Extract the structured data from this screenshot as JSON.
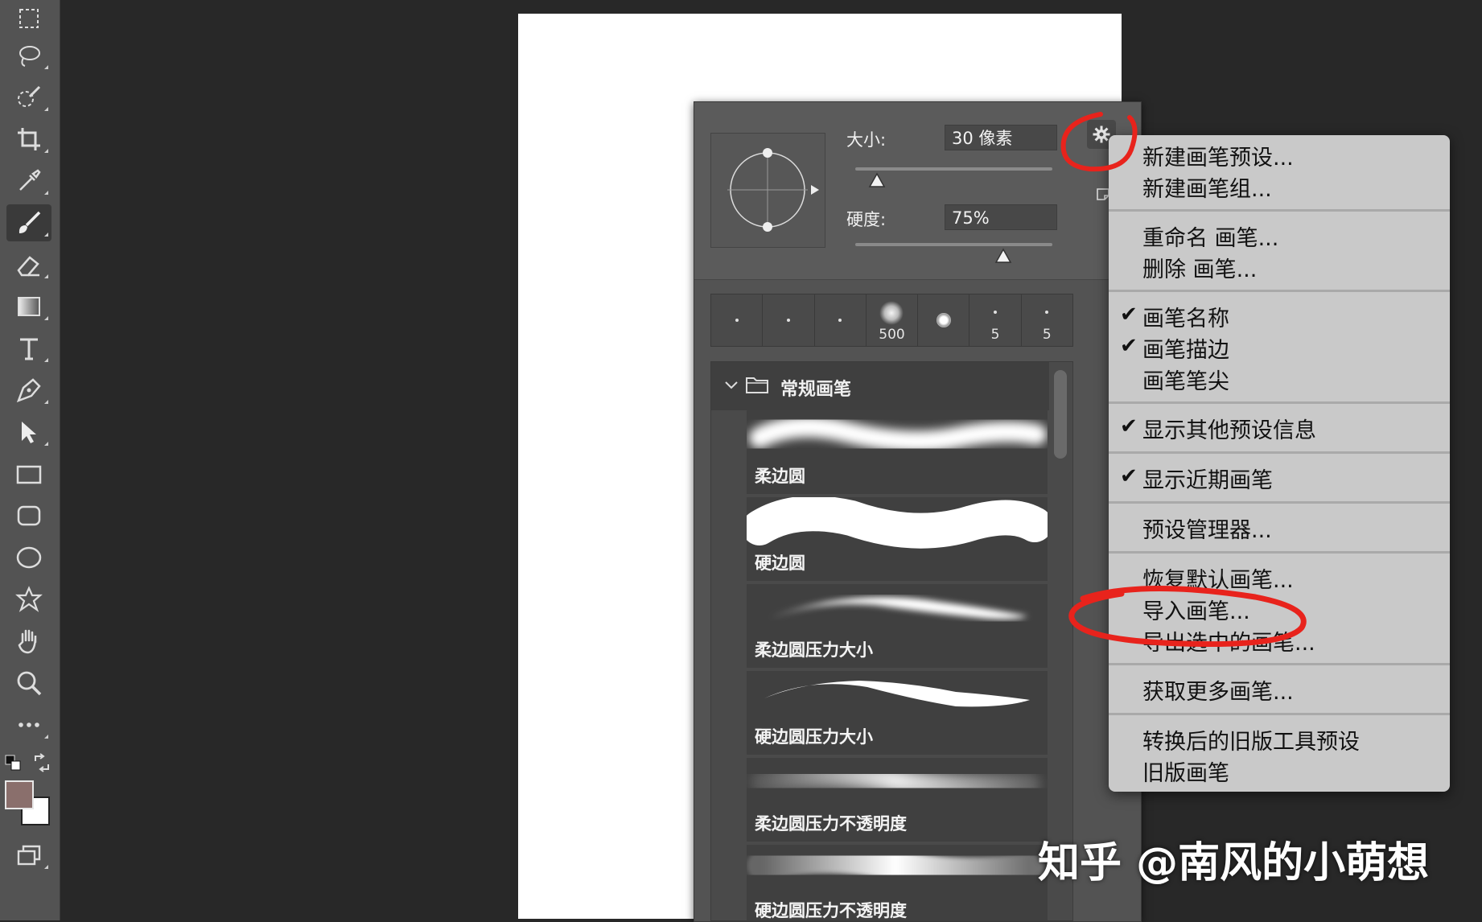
{
  "toolbar": {
    "tools": [
      {
        "name": "rectangular-marquee-tool"
      },
      {
        "name": "lasso-tool"
      },
      {
        "name": "quick-selection-tool"
      },
      {
        "name": "crop-tool"
      },
      {
        "name": "eyedropper-tool"
      },
      {
        "name": "brush-tool",
        "active": true
      },
      {
        "name": "eraser-tool"
      },
      {
        "name": "gradient-tool"
      },
      {
        "name": "type-tool"
      },
      {
        "name": "pen-tool"
      },
      {
        "name": "path-selection-tool"
      },
      {
        "name": "rectangle-tool"
      },
      {
        "name": "rounded-rectangle-tool"
      },
      {
        "name": "ellipse-tool"
      },
      {
        "name": "custom-shape-tool"
      },
      {
        "name": "hand-tool"
      },
      {
        "name": "zoom-tool"
      },
      {
        "name": "more-tools"
      }
    ],
    "foreground_color": "#8a6f6c",
    "background_color": "#ffffff"
  },
  "brush_panel": {
    "size_label": "大小:",
    "size_value": "30 像素",
    "size_slider_fraction": 0.11,
    "hardness_label": "硬度:",
    "hardness_value": "75%",
    "hardness_slider_fraction": 0.75,
    "gear_icon": "gear-icon",
    "recent_brushes": [
      {
        "label": ""
      },
      {
        "label": ""
      },
      {
        "label": ""
      },
      {
        "label": "500"
      },
      {
        "label": ""
      },
      {
        "label": "5"
      },
      {
        "label": "5"
      }
    ],
    "group_name": "常规画笔",
    "brushes": [
      {
        "name": "柔边圆"
      },
      {
        "name": "硬边圆"
      },
      {
        "name": "柔边圆压力大小"
      },
      {
        "name": "硬边圆压力大小"
      },
      {
        "name": "柔边圆压力不透明度"
      },
      {
        "name": "硬边圆压力不透明度"
      }
    ]
  },
  "menu": {
    "items": [
      {
        "label": "新建画笔预设...",
        "checked": false
      },
      {
        "label": "新建画笔组...",
        "checked": false
      },
      {
        "label": "重命名 画笔...",
        "checked": false
      },
      {
        "label": "删除 画笔...",
        "checked": false
      },
      {
        "label": "画笔名称",
        "checked": true
      },
      {
        "label": "画笔描边",
        "checked": true
      },
      {
        "label": "画笔笔尖",
        "checked": false
      },
      {
        "label": "显示其他预设信息",
        "checked": true
      },
      {
        "label": "显示近期画笔",
        "checked": true
      },
      {
        "label": "预设管理器...",
        "checked": false
      },
      {
        "label": "恢复默认画笔...",
        "checked": false
      },
      {
        "label": "导入画笔...",
        "checked": false
      },
      {
        "label": "导出选中的画笔...",
        "checked": false
      },
      {
        "label": "获取更多画笔...",
        "checked": false
      },
      {
        "label": "转换后的旧版工具预设",
        "checked": false
      },
      {
        "label": "旧版画笔",
        "checked": false
      }
    ]
  },
  "watermark": "知乎 @南风的小萌想"
}
